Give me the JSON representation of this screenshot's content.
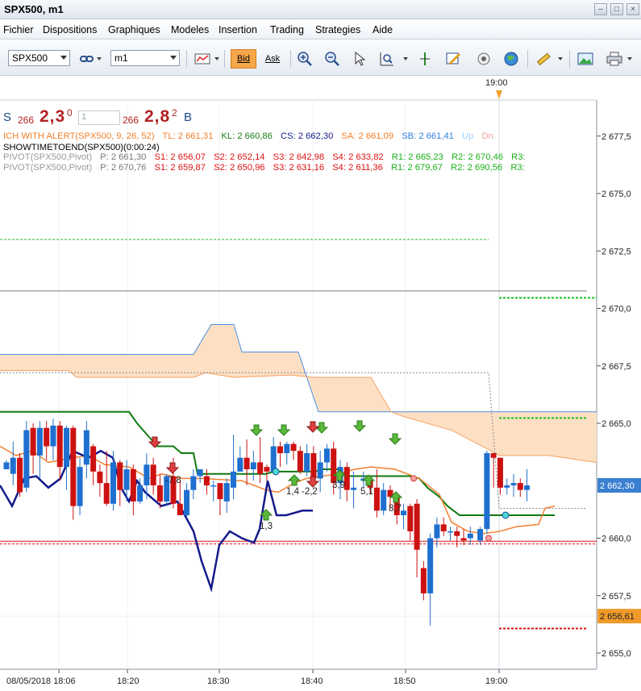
{
  "window": {
    "title": "SPX500, m1",
    "minimize_icon": "minimize-icon",
    "maximize_icon": "maximize-icon",
    "close_icon": "close-icon"
  },
  "menu": [
    "Fichier",
    "Dispositions",
    "Graphiques",
    "Modeles",
    "Insertion",
    "Trading",
    "Strategies",
    "Aide"
  ],
  "toolbar": {
    "symbol": "SPX500",
    "timeframe": "m1",
    "bid_label": "Bid",
    "ask_label": "Ask",
    "icons": [
      "chain-link-icon",
      "candlestick-type-icon",
      "crosshair-plus-icon",
      "crosshair-minus-icon",
      "cursor-icon",
      "zoom-icon",
      "vertical-line-icon",
      "edit-chart-icon",
      "eye-icon",
      "globe-icon",
      "ruler-icon",
      "image-icon",
      "print-icon"
    ]
  },
  "quote": {
    "sell_label": "S",
    "sell_small": "266",
    "sell_big": "2,3",
    "sell_sup": "0",
    "quantity": "1",
    "buy_small": "266",
    "buy_big": "2,8",
    "buy_sup": "2",
    "buy_label": "B"
  },
  "indicators": {
    "ich": {
      "name": "ICH WITH ALERT(SPX500, 9, 26, 52)",
      "tl": "TL: 2 661,31",
      "kl": "KL: 2 660,86",
      "cs": "CS: 2 662,30",
      "sa": "SA: 2 661,09",
      "sb": "SB: 2 661,41",
      "up": "Up",
      "dn": "Dn"
    },
    "showtime": "SHOWTIMETOEND(SPX500)(0:00:24)",
    "pivot1": {
      "name": "PIVOT(SPX500,Pivot)",
      "p": "P: 2 661,30",
      "s1": "S1: 2 656,07",
      "s2": "S2: 2 652,14",
      "s3": "S3: 2 642,98",
      "s4": "S4: 2 633,82",
      "r1": "R1: 2 665,23",
      "r2": "R2: 2 670,46",
      "r3": "R3:"
    },
    "pivot2": {
      "name": "PIVOT(SPX500,Pivot)",
      "p": "P: 2 670,76",
      "s1": "S1: 2 659,87",
      "s2": "S2: 2 650,96",
      "s3": "S3: 2 631,16",
      "s4": "S4: 2 611,36",
      "r1": "R1: 2 679,67",
      "r2": "R2: 2 690,56",
      "r3": "R3:"
    }
  },
  "chart_data": {
    "type": "candlestick",
    "symbol": "SPX500",
    "timeframe": "m1",
    "ylim": [
      2654.7,
      2678.0
    ],
    "y_ticks": [
      "2 677,5",
      "2 675,0",
      "2 672,5",
      "2 670,0",
      "2 667,5",
      "2 665,0",
      "2 662,30",
      "2 660,0",
      "2 657,5",
      "2 656,61",
      "2 655,0"
    ],
    "x_ticks": [
      "08/05/2018 18:06",
      "18:20",
      "18:30",
      "18:40",
      "18:50",
      "19:00"
    ],
    "top_time_marker": "19:00",
    "current_price_label": "2 662,30",
    "marker_price_label": "2 656,61",
    "colors": {
      "up": "#1f6fd0",
      "down": "#cc1111",
      "kijun": "#0f7a0f",
      "tenkan": "#f08030",
      "chikou": "#141a8a",
      "cloud": "#fde0c4",
      "cloud_edge": "#4a8ee0",
      "pivot_green": "#19c019",
      "pivot_red": "#dd1111",
      "price_tag": "#3a7fd0",
      "marker_tag": "#f09a2a"
    },
    "candles": [
      {
        "o": 2663.0,
        "c": 2663.3,
        "h": 2663.4,
        "l": 2663.0
      },
      {
        "o": 2662.8,
        "c": 2663.5,
        "h": 2664.2,
        "l": 2662.3
      },
      {
        "o": 2663.5,
        "c": 2662.0,
        "h": 2663.7,
        "l": 2661.8
      },
      {
        "o": 2662.2,
        "c": 2664.7,
        "h": 2665.1,
        "l": 2662.0
      },
      {
        "o": 2664.8,
        "c": 2663.6,
        "h": 2665.0,
        "l": 2662.8
      },
      {
        "o": 2663.6,
        "c": 2664.8,
        "h": 2665.1,
        "l": 2662.6
      },
      {
        "o": 2664.8,
        "c": 2664.0,
        "h": 2665.1,
        "l": 2663.4
      },
      {
        "o": 2664.0,
        "c": 2664.9,
        "h": 2665.2,
        "l": 2663.4
      },
      {
        "o": 2664.9,
        "c": 2663.1,
        "h": 2665.1,
        "l": 2662.5
      },
      {
        "o": 2663.1,
        "c": 2664.8,
        "h": 2664.9,
        "l": 2662.1
      },
      {
        "o": 2664.8,
        "c": 2661.4,
        "h": 2664.9,
        "l": 2660.8
      },
      {
        "o": 2661.4,
        "c": 2663.1,
        "h": 2663.5,
        "l": 2661.0
      },
      {
        "o": 2663.2,
        "c": 2664.7,
        "h": 2665.1,
        "l": 2662.6
      },
      {
        "o": 2664.0,
        "c": 2662.9,
        "h": 2664.1,
        "l": 2662.3
      },
      {
        "o": 2662.9,
        "c": 2662.4,
        "h": 2663.2,
        "l": 2661.8
      },
      {
        "o": 2662.4,
        "c": 2661.5,
        "h": 2663.8,
        "l": 2661.4
      },
      {
        "o": 2661.5,
        "c": 2663.3,
        "h": 2663.8,
        "l": 2661.2
      },
      {
        "o": 2663.3,
        "c": 2662.1,
        "h": 2663.4,
        "l": 2661.4
      },
      {
        "o": 2662.1,
        "c": 2663.0,
        "h": 2663.4,
        "l": 2661.6
      },
      {
        "o": 2663.0,
        "c": 2661.6,
        "h": 2663.2,
        "l": 2661.0
      },
      {
        "o": 2661.6,
        "c": 2662.3,
        "h": 2662.6,
        "l": 2661.5
      },
      {
        "o": 2662.3,
        "c": 2663.2,
        "h": 2663.7,
        "l": 2661.7
      },
      {
        "o": 2663.2,
        "c": 2662.3,
        "h": 2663.5,
        "l": 2661.9
      },
      {
        "o": 2662.3,
        "c": 2661.6,
        "h": 2662.8,
        "l": 2661.3
      },
      {
        "o": 2661.6,
        "c": 2662.7,
        "h": 2662.8,
        "l": 2661.4
      },
      {
        "o": 2662.7,
        "c": 2661.5,
        "h": 2663.5,
        "l": 2661.3
      },
      {
        "o": 2661.5,
        "c": 2661.0,
        "h": 2662.5,
        "l": 2661.0
      },
      {
        "o": 2661.0,
        "c": 2662.1,
        "h": 2662.4,
        "l": 2660.9
      },
      {
        "o": 2662.1,
        "c": 2662.7,
        "h": 2663.0,
        "l": 2661.7
      },
      {
        "o": 2662.7,
        "c": 2663.0,
        "h": 2663.0,
        "l": 2662.4
      },
      {
        "o": 2662.7,
        "c": 2662.3,
        "h": 2663.0,
        "l": 2661.9
      },
      {
        "o": 2662.3,
        "c": 2662.3,
        "h": 2662.5,
        "l": 2661.6
      },
      {
        "o": 2662.4,
        "c": 2661.7,
        "h": 2662.4,
        "l": 2661.0
      },
      {
        "o": 2661.6,
        "c": 2662.4,
        "h": 2662.6,
        "l": 2661.1
      },
      {
        "o": 2662.2,
        "c": 2662.9,
        "h": 2664.5,
        "l": 2661.7
      },
      {
        "o": 2662.9,
        "c": 2663.5,
        "h": 2664.0,
        "l": 2662.9
      },
      {
        "o": 2663.5,
        "c": 2663.0,
        "h": 2664.3,
        "l": 2662.3
      },
      {
        "o": 2663.0,
        "c": 2663.3,
        "h": 2663.8,
        "l": 2662.5
      },
      {
        "o": 2663.3,
        "c": 2662.8,
        "h": 2664.4,
        "l": 2662.4
      },
      {
        "o": 2663.1,
        "c": 2662.9,
        "h": 2663.2,
        "l": 2662.5
      },
      {
        "o": 2662.9,
        "c": 2664.0,
        "h": 2664.4,
        "l": 2662.8
      },
      {
        "o": 2664.0,
        "c": 2663.7,
        "h": 2664.2,
        "l": 2663.1
      },
      {
        "o": 2663.7,
        "c": 2664.1,
        "h": 2664.2,
        "l": 2663.2
      },
      {
        "o": 2664.1,
        "c": 2663.8,
        "h": 2664.2,
        "l": 2663.4
      },
      {
        "o": 2663.8,
        "c": 2662.9,
        "h": 2664.0,
        "l": 2662.8
      },
      {
        "o": 2662.9,
        "c": 2663.7,
        "h": 2664.1,
        "l": 2662.7
      },
      {
        "o": 2663.7,
        "c": 2662.6,
        "h": 2664.0,
        "l": 2662.5
      },
      {
        "o": 2662.6,
        "c": 2663.3,
        "h": 2663.8,
        "l": 2662.0
      },
      {
        "o": 2663.3,
        "c": 2663.9,
        "h": 2664.1,
        "l": 2662.9
      },
      {
        "o": 2663.9,
        "c": 2662.4,
        "h": 2664.2,
        "l": 2661.9
      },
      {
        "o": 2662.4,
        "c": 2663.1,
        "h": 2663.4,
        "l": 2661.7
      },
      {
        "o": 2663.1,
        "c": 2662.1,
        "h": 2663.3,
        "l": 2661.6
      },
      {
        "o": 2662.1,
        "c": 2662.2,
        "h": 2662.9,
        "l": 2661.3
      },
      {
        "o": 2662.5,
        "c": 2662.6,
        "h": 2662.9,
        "l": 2662.2
      },
      {
        "o": 2662.5,
        "c": 2662.2,
        "h": 2662.7,
        "l": 2661.9
      },
      {
        "o": 2662.2,
        "c": 2661.2,
        "h": 2663.0,
        "l": 2660.9
      },
      {
        "o": 2661.2,
        "c": 2662.1,
        "h": 2662.4,
        "l": 2661.0
      },
      {
        "o": 2662.1,
        "c": 2661.8,
        "h": 2662.3,
        "l": 2661.3
      },
      {
        "o": 2661.8,
        "c": 2661.0,
        "h": 2662.0,
        "l": 2660.6
      },
      {
        "o": 2661.0,
        "c": 2661.2,
        "h": 2661.5,
        "l": 2660.4
      },
      {
        "o": 2661.4,
        "c": 2660.3,
        "h": 2661.5,
        "l": 2659.9
      },
      {
        "o": 2661.5,
        "c": 2659.5,
        "h": 2661.7,
        "l": 2658.3
      },
      {
        "o": 2658.7,
        "c": 2657.6,
        "h": 2659.0,
        "l": 2657.3
      },
      {
        "o": 2657.6,
        "c": 2660.0,
        "h": 2660.2,
        "l": 2656.2
      },
      {
        "o": 2660.0,
        "c": 2660.6,
        "h": 2660.9,
        "l": 2659.6
      },
      {
        "o": 2660.6,
        "c": 2660.3,
        "h": 2660.9,
        "l": 2660.1
      },
      {
        "o": 2660.3,
        "c": 2660.3,
        "h": 2660.5,
        "l": 2659.9
      },
      {
        "o": 2660.3,
        "c": 2660.1,
        "h": 2660.5,
        "l": 2659.6
      },
      {
        "o": 2660.0,
        "c": 2659.9,
        "h": 2660.4,
        "l": 2659.7
      },
      {
        "o": 2660.0,
        "c": 2660.2,
        "h": 2660.5,
        "l": 2659.7
      },
      {
        "o": 2659.9,
        "c": 2660.4,
        "h": 2660.5,
        "l": 2659.7
      },
      {
        "o": 2660.4,
        "c": 2663.7,
        "h": 2663.8,
        "l": 2660.2
      },
      {
        "o": 2663.7,
        "c": 2663.5,
        "h": 2663.7,
        "l": 2662.2
      },
      {
        "o": 2663.5,
        "c": 2662.2,
        "h": 2663.5,
        "l": 2661.9
      },
      {
        "o": 2662.2,
        "c": 2662.3,
        "h": 2662.6,
        "l": 2661.9
      },
      {
        "o": 2662.3,
        "c": 2662.4,
        "h": 2662.8,
        "l": 2661.8
      },
      {
        "o": 2662.4,
        "c": 2662.1,
        "h": 2662.6,
        "l": 2661.8
      },
      {
        "o": 2662.1,
        "c": 2662.3,
        "h": 2663.0,
        "l": 2661.6
      }
    ],
    "signal_labels": [
      "-7,8",
      "1,3",
      "1,4",
      "-2,2",
      "3,9",
      "5,1",
      "8,7"
    ],
    "buy_arrow_count": 6,
    "sell_arrow_count": 4
  }
}
